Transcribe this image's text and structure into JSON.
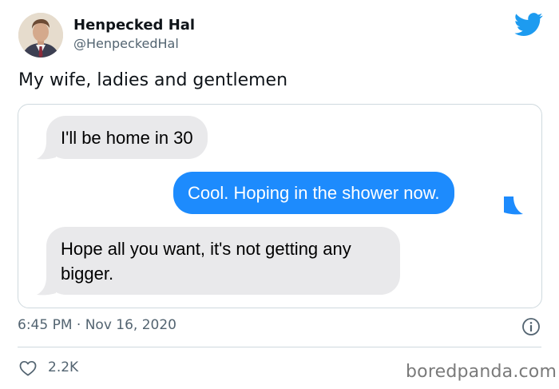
{
  "author": {
    "display_name": "Henpecked Hal",
    "handle": "@HenpeckedHal"
  },
  "tweet": {
    "text": "My wife, ladies and gentlemen",
    "timestamp": "6:45 PM · Nov 16, 2020",
    "likes": "2.2K"
  },
  "messages": [
    {
      "direction": "incoming",
      "text": "I'll be home in 30"
    },
    {
      "direction": "outgoing",
      "text": "Cool. Hoping in the shower now."
    },
    {
      "direction": "incoming",
      "text": "Hope all you want, it's not getting any bigger."
    }
  ],
  "watermark": "boredpanda.com",
  "icons": {
    "brand": "twitter-bird-icon",
    "info": "info-icon",
    "like": "heart-icon"
  },
  "colors": {
    "twitter_blue": "#1d9bf0",
    "imessage_blue": "#1d8bfd",
    "incoming_bubble": "#e9e9eb",
    "secondary_text": "#536471"
  }
}
